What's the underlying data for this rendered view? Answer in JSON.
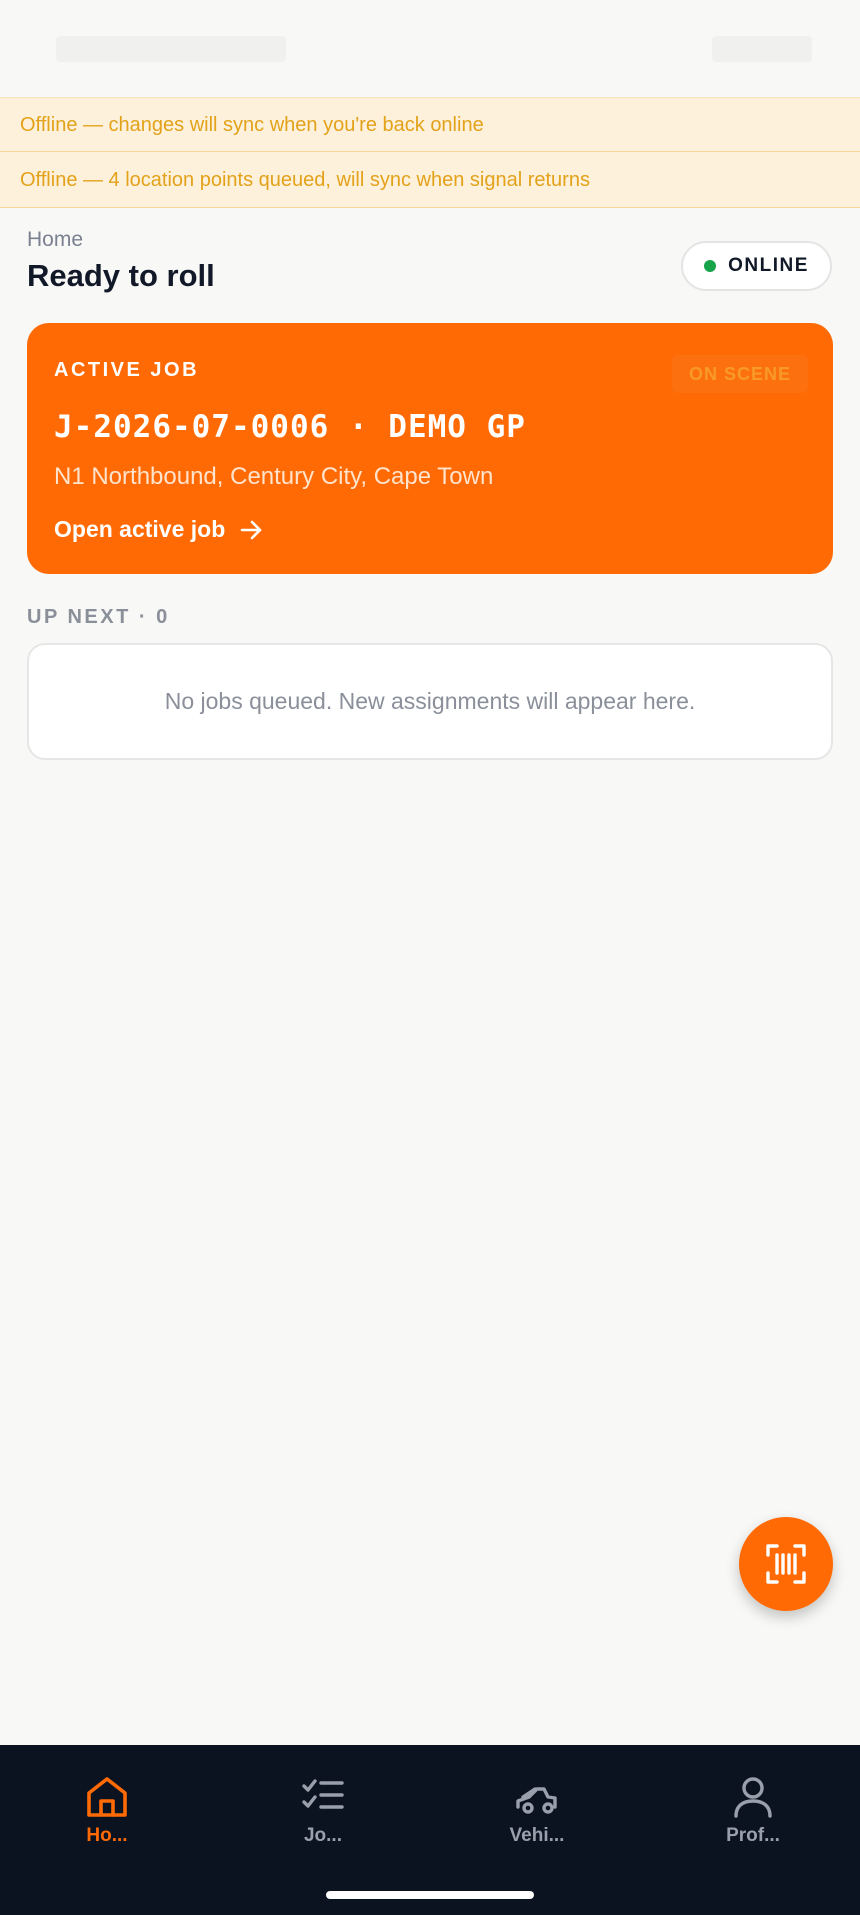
{
  "banners": {
    "offline_changes": "Offline — changes will sync when you're back online",
    "offline_location": "Offline — 4 location points queued, will sync when signal returns"
  },
  "header": {
    "breadcrumb": "Home",
    "title": "Ready to roll",
    "connection_status": "ONLINE"
  },
  "active_job": {
    "kicker": "ACTIVE JOB",
    "status": "ON SCENE",
    "job_id": "J-2026-07-0006 · DEMO GP",
    "location": "N1 Northbound, Century City, Cape Town",
    "open_label": "Open active job"
  },
  "up_next": {
    "label": "UP NEXT · 0",
    "empty_message": "No jobs queued. New assignments will appear here."
  },
  "fab": {
    "icon": "scan-icon"
  },
  "nav": {
    "items": [
      {
        "label": "Ho...",
        "icon": "home-icon",
        "active": true
      },
      {
        "label": "Jo...",
        "icon": "checklist-icon",
        "active": false
      },
      {
        "label": "Vehi...",
        "icon": "tow-truck-icon",
        "active": false
      },
      {
        "label": "Prof...",
        "icon": "user-icon",
        "active": false
      }
    ]
  },
  "colors": {
    "accent": "#ff6a05",
    "online": "#16a34a",
    "banner_bg": "#fdf1dc",
    "banner_text": "#e3a21a",
    "nav_bg": "#0b1220"
  }
}
